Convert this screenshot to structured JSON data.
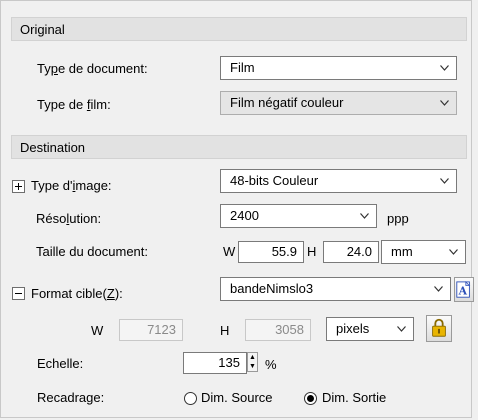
{
  "original": {
    "header": "Original",
    "doc_type_label": "Type de document:",
    "doc_type_value": "Film",
    "film_type_label": "Type de film:",
    "film_type_value": "Film négatif couleur"
  },
  "destination": {
    "header": "Destination",
    "image_type_label": "Type d'image:",
    "image_type_value": "48-bits Couleur",
    "resolution_label": "Résolution:",
    "resolution_value": "2400",
    "resolution_unit": "ppp",
    "doc_size_label": "Taille du document:",
    "w_label": "W",
    "doc_width": "55.9",
    "h_label": "H",
    "doc_height": "24.0",
    "doc_unit": "mm",
    "target_label": "Format cible(Z):",
    "target_value": "bandeNimslo3",
    "target_w_label": "W",
    "target_width": "7123",
    "target_h_label": "H",
    "target_height": "3058",
    "target_unit": "pixels",
    "scale_label": "Echelle:",
    "scale_value": "135",
    "scale_unit": "%",
    "crop_label": "Recadrage:",
    "crop_option_source": "Dim. Source",
    "crop_option_output": "Dim. Sortie",
    "crop_selected": "Dim. Sortie"
  },
  "icons": {
    "text_icon": "a-text-icon",
    "lock_icon": "lock-icon"
  },
  "colors": {
    "header_bg": "#e2e2e2",
    "panel_bg": "#f0f0f0",
    "text_icon_blue": "#2c4fb8",
    "lock_gold": "#e8b400"
  }
}
